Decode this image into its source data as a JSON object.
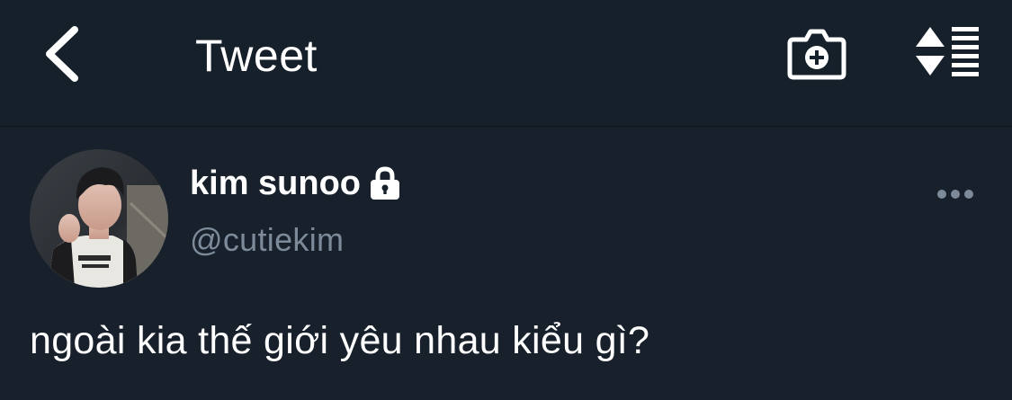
{
  "header": {
    "title": "Tweet",
    "back_icon": "chevron-left-icon",
    "camera_icon": "camera-plus-icon",
    "sort_icon": "sort-toggle-icon"
  },
  "tweet": {
    "display_name": "kim sunoo",
    "handle": "@cutiekim",
    "text": "ngoài kia thế giới yêu nhau kiểu gì?",
    "protected_icon": "lock-icon",
    "more_icon": "more-horizontal-icon"
  },
  "colors": {
    "background": "#17202b",
    "text_primary": "#ffffff",
    "text_secondary": "#7d8a99"
  }
}
